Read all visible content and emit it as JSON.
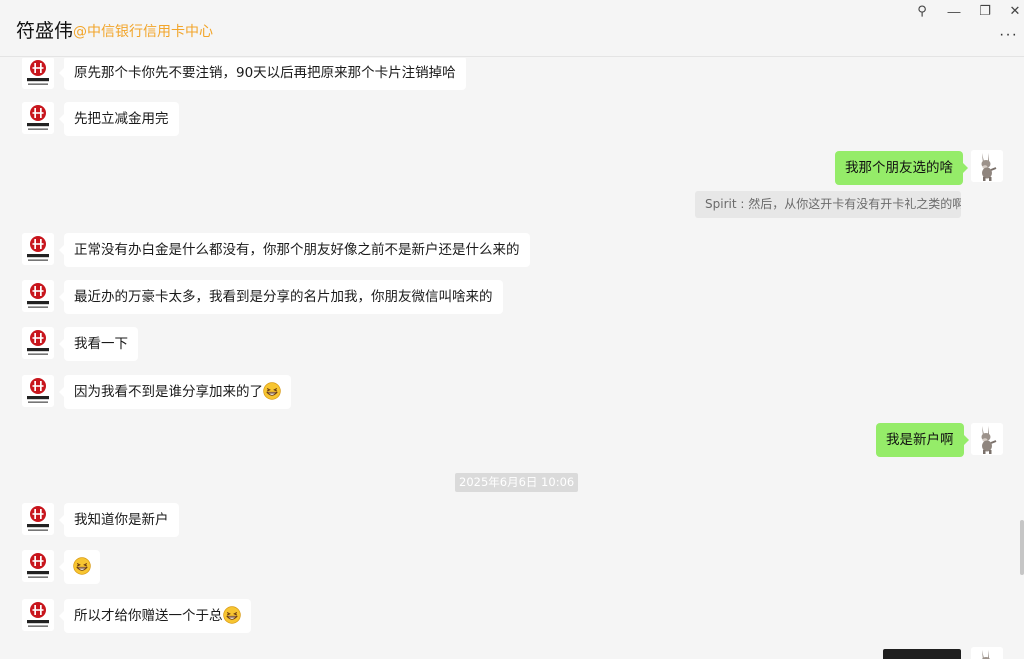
{
  "header": {
    "title": "符盛伟",
    "subtitle": "@中信银行信用卡中心",
    "pin_glyph": "⚲",
    "minimize_glyph": "—",
    "restore_glyph": "❐",
    "close_glyph": "✕",
    "more_glyph": "···"
  },
  "messages": [
    {
      "side": "left",
      "text": "原先那个卡你先不要注销，90天以后再把原来那个卡片注销掉哈"
    },
    {
      "side": "left",
      "text": "先把立减金用完"
    },
    {
      "side": "right",
      "text": "我那个朋友选的啥"
    },
    {
      "quote": "Spirit : 然后，从你这开卡有没有开卡礼之类的啊"
    },
    {
      "side": "left",
      "text": "正常没有办白金是什么都没有，你那个朋友好像之前不是新户还是什么来的"
    },
    {
      "side": "left",
      "text": "最近办的万豪卡太多，我看到是分享的名片加我，你朋友微信叫啥来的"
    },
    {
      "side": "left",
      "text": "我看一下"
    },
    {
      "side": "left",
      "text": "因为我看不到是谁分享加来的了"
    },
    {
      "side": "right",
      "text": "我是新户啊"
    },
    {
      "timestamp": "2025年6月6日 10:06"
    },
    {
      "side": "left",
      "text": "我知道你是新户"
    },
    {
      "side": "left",
      "emoji": "grin"
    },
    {
      "side": "left",
      "text": "所以才给你赠送一个于总"
    }
  ],
  "colors": {
    "accent_subtitle": "#f2a52a",
    "own_bubble": "#95ec69",
    "other_bubble": "#ffffff",
    "background": "#f5f5f5",
    "bank_red": "#c8161d"
  },
  "icons": {
    "bank_avatar": "citic-bank-logo-icon",
    "user_avatar": "donkey-avatar-icon",
    "emoji": "grinning-squint-emoji-icon"
  }
}
